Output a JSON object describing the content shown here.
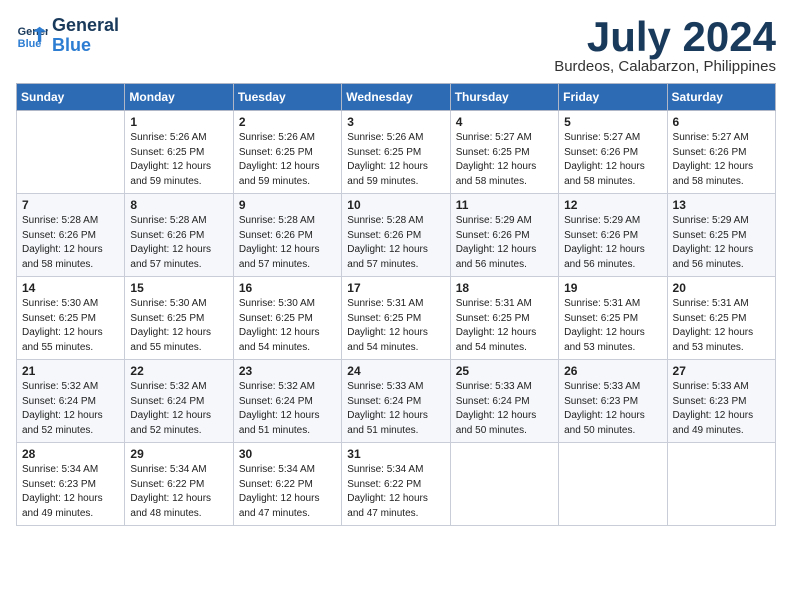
{
  "header": {
    "logo_line1": "General",
    "logo_line2": "Blue",
    "month": "July 2024",
    "location": "Burdeos, Calabarzon, Philippines"
  },
  "days_of_week": [
    "Sunday",
    "Monday",
    "Tuesday",
    "Wednesday",
    "Thursday",
    "Friday",
    "Saturday"
  ],
  "weeks": [
    [
      {
        "day": "",
        "info": ""
      },
      {
        "day": "1",
        "info": "Sunrise: 5:26 AM\nSunset: 6:25 PM\nDaylight: 12 hours\nand 59 minutes."
      },
      {
        "day": "2",
        "info": "Sunrise: 5:26 AM\nSunset: 6:25 PM\nDaylight: 12 hours\nand 59 minutes."
      },
      {
        "day": "3",
        "info": "Sunrise: 5:26 AM\nSunset: 6:25 PM\nDaylight: 12 hours\nand 59 minutes."
      },
      {
        "day": "4",
        "info": "Sunrise: 5:27 AM\nSunset: 6:25 PM\nDaylight: 12 hours\nand 58 minutes."
      },
      {
        "day": "5",
        "info": "Sunrise: 5:27 AM\nSunset: 6:26 PM\nDaylight: 12 hours\nand 58 minutes."
      },
      {
        "day": "6",
        "info": "Sunrise: 5:27 AM\nSunset: 6:26 PM\nDaylight: 12 hours\nand 58 minutes."
      }
    ],
    [
      {
        "day": "7",
        "info": "Sunrise: 5:28 AM\nSunset: 6:26 PM\nDaylight: 12 hours\nand 58 minutes."
      },
      {
        "day": "8",
        "info": "Sunrise: 5:28 AM\nSunset: 6:26 PM\nDaylight: 12 hours\nand 57 minutes."
      },
      {
        "day": "9",
        "info": "Sunrise: 5:28 AM\nSunset: 6:26 PM\nDaylight: 12 hours\nand 57 minutes."
      },
      {
        "day": "10",
        "info": "Sunrise: 5:28 AM\nSunset: 6:26 PM\nDaylight: 12 hours\nand 57 minutes."
      },
      {
        "day": "11",
        "info": "Sunrise: 5:29 AM\nSunset: 6:26 PM\nDaylight: 12 hours\nand 56 minutes."
      },
      {
        "day": "12",
        "info": "Sunrise: 5:29 AM\nSunset: 6:26 PM\nDaylight: 12 hours\nand 56 minutes."
      },
      {
        "day": "13",
        "info": "Sunrise: 5:29 AM\nSunset: 6:25 PM\nDaylight: 12 hours\nand 56 minutes."
      }
    ],
    [
      {
        "day": "14",
        "info": "Sunrise: 5:30 AM\nSunset: 6:25 PM\nDaylight: 12 hours\nand 55 minutes."
      },
      {
        "day": "15",
        "info": "Sunrise: 5:30 AM\nSunset: 6:25 PM\nDaylight: 12 hours\nand 55 minutes."
      },
      {
        "day": "16",
        "info": "Sunrise: 5:30 AM\nSunset: 6:25 PM\nDaylight: 12 hours\nand 54 minutes."
      },
      {
        "day": "17",
        "info": "Sunrise: 5:31 AM\nSunset: 6:25 PM\nDaylight: 12 hours\nand 54 minutes."
      },
      {
        "day": "18",
        "info": "Sunrise: 5:31 AM\nSunset: 6:25 PM\nDaylight: 12 hours\nand 54 minutes."
      },
      {
        "day": "19",
        "info": "Sunrise: 5:31 AM\nSunset: 6:25 PM\nDaylight: 12 hours\nand 53 minutes."
      },
      {
        "day": "20",
        "info": "Sunrise: 5:31 AM\nSunset: 6:25 PM\nDaylight: 12 hours\nand 53 minutes."
      }
    ],
    [
      {
        "day": "21",
        "info": "Sunrise: 5:32 AM\nSunset: 6:24 PM\nDaylight: 12 hours\nand 52 minutes."
      },
      {
        "day": "22",
        "info": "Sunrise: 5:32 AM\nSunset: 6:24 PM\nDaylight: 12 hours\nand 52 minutes."
      },
      {
        "day": "23",
        "info": "Sunrise: 5:32 AM\nSunset: 6:24 PM\nDaylight: 12 hours\nand 51 minutes."
      },
      {
        "day": "24",
        "info": "Sunrise: 5:33 AM\nSunset: 6:24 PM\nDaylight: 12 hours\nand 51 minutes."
      },
      {
        "day": "25",
        "info": "Sunrise: 5:33 AM\nSunset: 6:24 PM\nDaylight: 12 hours\nand 50 minutes."
      },
      {
        "day": "26",
        "info": "Sunrise: 5:33 AM\nSunset: 6:23 PM\nDaylight: 12 hours\nand 50 minutes."
      },
      {
        "day": "27",
        "info": "Sunrise: 5:33 AM\nSunset: 6:23 PM\nDaylight: 12 hours\nand 49 minutes."
      }
    ],
    [
      {
        "day": "28",
        "info": "Sunrise: 5:34 AM\nSunset: 6:23 PM\nDaylight: 12 hours\nand 49 minutes."
      },
      {
        "day": "29",
        "info": "Sunrise: 5:34 AM\nSunset: 6:22 PM\nDaylight: 12 hours\nand 48 minutes."
      },
      {
        "day": "30",
        "info": "Sunrise: 5:34 AM\nSunset: 6:22 PM\nDaylight: 12 hours\nand 47 minutes."
      },
      {
        "day": "31",
        "info": "Sunrise: 5:34 AM\nSunset: 6:22 PM\nDaylight: 12 hours\nand 47 minutes."
      },
      {
        "day": "",
        "info": ""
      },
      {
        "day": "",
        "info": ""
      },
      {
        "day": "",
        "info": ""
      }
    ]
  ]
}
